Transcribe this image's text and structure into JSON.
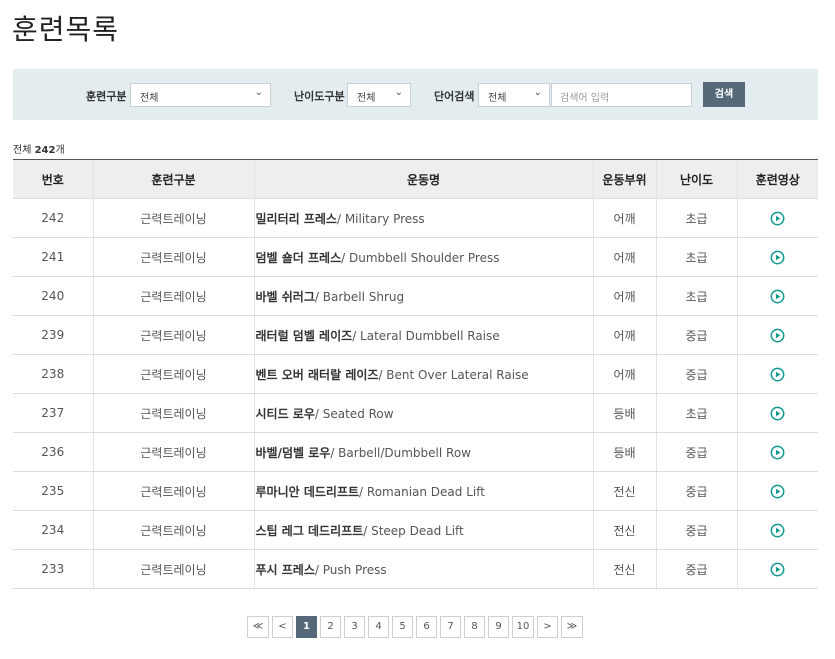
{
  "page": {
    "title": "훈련목록"
  },
  "search": {
    "category_label": "훈련구분",
    "category_value": "전체",
    "level_label": "난이도구분",
    "level_value": "전체",
    "keyword_label": "단어검색",
    "keyword_scope": "전체",
    "keyword_placeholder": "검색어 입력",
    "button_label": "검색"
  },
  "total": {
    "prefix": "전체 ",
    "count": "242",
    "suffix": "개"
  },
  "table": {
    "headers": [
      "번호",
      "훈련구분",
      "운동명",
      "운동부위",
      "난이도",
      "훈련영상"
    ],
    "rows": [
      {
        "no": "242",
        "category": "근력트레이닝",
        "name_ko": "밀리터리 프레스",
        "name_en": "/ Military Press",
        "part": "어깨",
        "level": "초급"
      },
      {
        "no": "241",
        "category": "근력트레이닝",
        "name_ko": "덤벨 숄더 프레스",
        "name_en": "/ Dumbbell Shoulder Press",
        "part": "어깨",
        "level": "초급"
      },
      {
        "no": "240",
        "category": "근력트레이닝",
        "name_ko": "바벨 쉬러그",
        "name_en": "/ Barbell Shrug",
        "part": "어깨",
        "level": "초급"
      },
      {
        "no": "239",
        "category": "근력트레이닝",
        "name_ko": "래터럴 덤벨 레이즈",
        "name_en": "/ Lateral Dumbbell Raise",
        "part": "어깨",
        "level": "중급"
      },
      {
        "no": "238",
        "category": "근력트레이닝",
        "name_ko": "벤트 오버 래터랄 레이즈",
        "name_en": "/ Bent Over Lateral Raise",
        "part": "어깨",
        "level": "중급"
      },
      {
        "no": "237",
        "category": "근력트레이닝",
        "name_ko": "시티드 로우",
        "name_en": "/ Seated Row",
        "part": "등배",
        "level": "초급"
      },
      {
        "no": "236",
        "category": "근력트레이닝",
        "name_ko": "바벨/덤벨 로우",
        "name_en": "/ Barbell/Dumbbell Row",
        "part": "등배",
        "level": "중급"
      },
      {
        "no": "235",
        "category": "근력트레이닝",
        "name_ko": "루마니안 데드리프트",
        "name_en": "/ Romanian Dead Lift",
        "part": "전신",
        "level": "중급"
      },
      {
        "no": "234",
        "category": "근력트레이닝",
        "name_ko": "스팁 레그 데드리프트",
        "name_en": "/ Steep Dead Lift",
        "part": "전신",
        "level": "중급"
      },
      {
        "no": "233",
        "category": "근력트레이닝",
        "name_ko": "푸시 프레스",
        "name_en": "/ Push Press",
        "part": "전신",
        "level": "중급"
      }
    ]
  },
  "pagination": {
    "first": "≪",
    "prev": "<",
    "next": ">",
    "last": "≫",
    "pages": [
      "1",
      "2",
      "3",
      "4",
      "5",
      "6",
      "7",
      "8",
      "9",
      "10"
    ],
    "current": "1"
  },
  "colors": {
    "accent": "#56697a",
    "panel_bg": "#e3edf0",
    "play_icon": "#0f9a8e"
  },
  "icons": {
    "play": "play-circle-icon",
    "chevron": "chevron-down-icon"
  }
}
